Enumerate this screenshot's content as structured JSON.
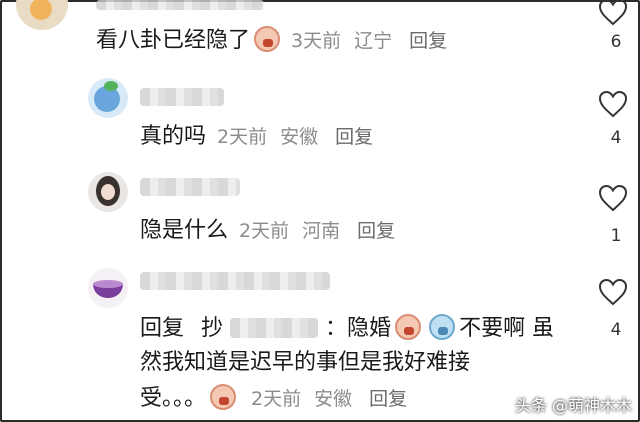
{
  "comments": [
    {
      "text": "看八卦已经隐了",
      "time": "3天前",
      "location": "辽宁",
      "reply": "回复",
      "likes": "6"
    },
    {
      "text": "真的吗",
      "time": "2天前",
      "location": "安徽",
      "reply": "回复",
      "likes": "4"
    },
    {
      "text": "隐是什么",
      "time": "2天前",
      "location": "河南",
      "reply": "回复",
      "likes": "1"
    },
    {
      "reply_prefix": "回复",
      "reply_target_initial": "抄",
      "colon": "：",
      "text_part1": "隐婚",
      "text_part2": "不要啊 虽",
      "text_line2": "然我知道是迟早的事但是我好难接",
      "text_line3": "受。。。",
      "time": "2天前",
      "location": "安徽",
      "reply": "回复",
      "likes": "4"
    }
  ],
  "watermark": "头条 @萌神木木"
}
